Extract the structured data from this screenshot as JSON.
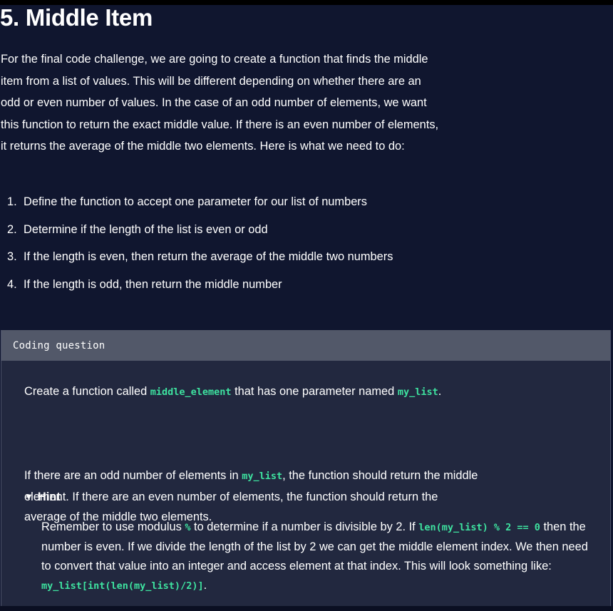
{
  "lesson": {
    "title": "5. Middle Item",
    "intro": "For the final code challenge, we are going to create a function that finds the middle item from a list of values. This will be different depending on whether there are an odd or even number of values. In the case of an odd number of elements, we want this function to return the exact middle value. If there is an even number of elements, it returns the average of the middle two elements. Here is what we need to do:",
    "steps": [
      {
        "num": "1.",
        "text": "Define the function to accept one parameter for our list of numbers"
      },
      {
        "num": "2.",
        "text": "Determine if the length of the list is even or odd"
      },
      {
        "num": "3.",
        "text": "If the length is even, then return the average of the middle two numbers"
      },
      {
        "num": "4.",
        "text": "If the length is odd, then return the middle number"
      }
    ]
  },
  "coding_question": {
    "header": "Coding question",
    "line1": {
      "t1": "Create a function called ",
      "c1": "middle_element",
      "t2": " that has one parameter named ",
      "c2": "my_list",
      "t3": "."
    },
    "para2": {
      "t1": "If there are an odd number of elements in ",
      "c1": "my_list",
      "t2": ", the function should return the middle element. If there are an even number of elements, the function should return the average of the middle two elements."
    },
    "hint": {
      "toggle_icon": "▼",
      "label": "Hint",
      "t1": "Remember to use modulus ",
      "c1": "%",
      "t2": " to determine if a number is divisible by 2. If ",
      "c2": "len(my_list) % 2 == 0",
      "t3": " then the number is even. If we divide the length of the list by 2 we can get the middle element index. We then need to convert that value into an integer and access element at that index. This will look something like: ",
      "c3": "my_list[int(len(my_list)/2)]",
      "t4": "."
    }
  },
  "colors": {
    "background": "#10162f",
    "panel": "#22283f",
    "panel_header": "#525869",
    "code_accent": "#3ee3a0"
  }
}
